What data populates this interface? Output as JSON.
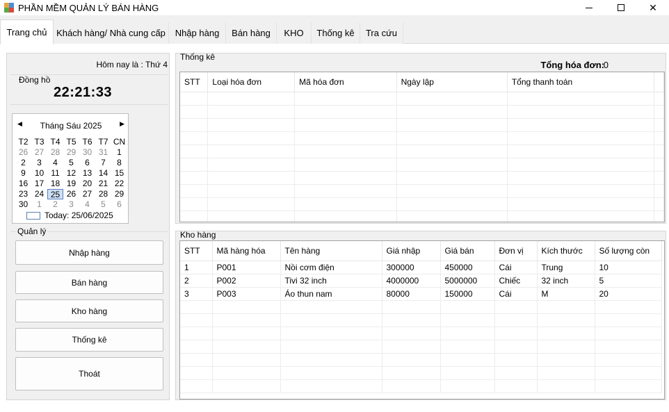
{
  "window": {
    "title": "PHẦN MỀM QUẢN LÝ BÁN HÀNG",
    "minimize": "",
    "maximize": "",
    "close": "✕"
  },
  "tabs": [
    {
      "label": "Trang chủ"
    },
    {
      "label": "Khách hàng/ Nhà cung cấp"
    },
    {
      "label": "Nhập hàng"
    },
    {
      "label": "Bán hàng"
    },
    {
      "label": "KHO"
    },
    {
      "label": "Thống kê"
    },
    {
      "label": "Tra cứu"
    }
  ],
  "left": {
    "today_text": "Hôm nay là : Thứ 4",
    "clock_caption": "Đồng hồ",
    "clock_time": "22:21:33",
    "calendar": {
      "month": "Tháng Sáu 2025",
      "prev": "◀",
      "next": "▶",
      "dow": [
        "T2",
        "T3",
        "T4",
        "T5",
        "T6",
        "T7",
        "CN"
      ],
      "days": [
        [
          "26",
          "27",
          "28",
          "29",
          "30",
          "31",
          "1"
        ],
        [
          "2",
          "3",
          "4",
          "5",
          "6",
          "7",
          "8"
        ],
        [
          "9",
          "10",
          "11",
          "12",
          "13",
          "14",
          "15"
        ],
        [
          "16",
          "17",
          "18",
          "19",
          "20",
          "21",
          "22"
        ],
        [
          "23",
          "24",
          "25",
          "26",
          "27",
          "28",
          "29"
        ],
        [
          "30",
          "1",
          "2",
          "3",
          "4",
          "5",
          "6"
        ]
      ],
      "today": "Today: 25/06/2025"
    },
    "quanly_caption": "Quản lý",
    "buttons": {
      "nhap_hang": "Nhập hàng",
      "ban_hang": "Bán hàng",
      "kho_hang": "Kho hàng",
      "thong_ke": "Thống kê",
      "thoat": "Thoát"
    }
  },
  "thongke": {
    "caption": "Thống kê",
    "total_label": "Tổng hóa đơn:",
    "total_value": "0",
    "columns": [
      "STT",
      "Loại hóa đơn",
      "Mã hóa đơn",
      "Ngày lập",
      "Tổng thanh toán"
    ]
  },
  "khohang": {
    "caption": "Kho hàng",
    "columns": [
      "STT",
      "Mã hàng hóa",
      "Tên hàng",
      "Giá nhập",
      "Giá bán",
      "Đơn vị",
      "Kích thước",
      "Số lượng còn"
    ],
    "rows": [
      [
        "1",
        "P001",
        "Nồi cơm điện",
        "300000",
        "450000",
        "Cái",
        "Trung",
        "10"
      ],
      [
        "2",
        "P002",
        "Tivi 32 inch",
        "4000000",
        "5000000",
        "Chiếc",
        "32 inch",
        "5"
      ],
      [
        "3",
        "P003",
        "Áo thun nam",
        "80000",
        "150000",
        "Cái",
        "M",
        "20"
      ]
    ]
  }
}
